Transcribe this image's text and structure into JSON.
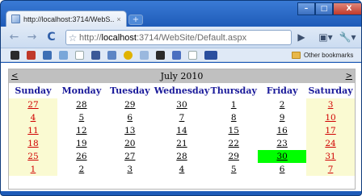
{
  "browser": {
    "tab_title": "http://localhost:3714/WebS...",
    "tab_close": "×",
    "new_tab": "+",
    "window_controls": {
      "minimize": "–",
      "maximize": "□",
      "close": "X"
    },
    "nav": {
      "back": "←",
      "forward": "→",
      "reload": "C"
    },
    "address": {
      "scheme": "http://",
      "host": "localhost",
      "path": ":3714/WebSite/Default.aspx"
    },
    "bookmarks_bar": {
      "other_label": "Other bookmarks"
    }
  },
  "calendar": {
    "month_label": "July 2010",
    "prev": "<",
    "next": ">",
    "day_headers": [
      "Sunday",
      "Monday",
      "Tuesday",
      "Wednesday",
      "Thursday",
      "Friday",
      "Saturday"
    ],
    "weeks": [
      [
        "27",
        "28",
        "29",
        "30",
        "1",
        "2",
        "3"
      ],
      [
        "4",
        "5",
        "6",
        "7",
        "8",
        "9",
        "10"
      ],
      [
        "11",
        "12",
        "13",
        "14",
        "15",
        "16",
        "17"
      ],
      [
        "18",
        "19",
        "20",
        "21",
        "22",
        "23",
        "24"
      ],
      [
        "25",
        "26",
        "27",
        "28",
        "29",
        "30",
        "31"
      ],
      [
        "1",
        "2",
        "3",
        "4",
        "5",
        "6",
        "7"
      ]
    ],
    "selected_day": "30",
    "colors": {
      "title_bg": "#c0c0c0",
      "header_text": "#1a1a9a",
      "weekend_bg": "#fafad2",
      "weekend_text": "#d00000",
      "selected_bg": "#00ff00"
    }
  }
}
